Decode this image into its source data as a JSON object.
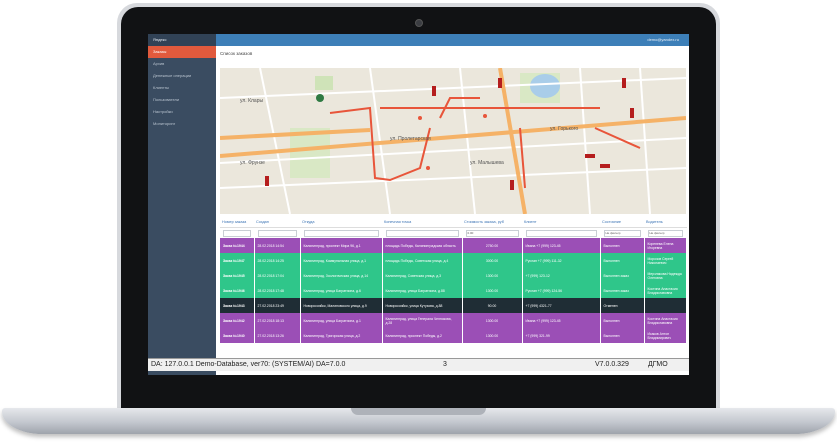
{
  "app": {
    "brand": "Яндекс"
  },
  "sidebar": {
    "items": [
      {
        "label": "Заказы",
        "active": true
      },
      {
        "label": "Архив",
        "active": false
      },
      {
        "label": "Денежные операции",
        "active": false
      },
      {
        "label": "Клиенты",
        "active": false
      },
      {
        "label": "Пользователи",
        "active": false
      },
      {
        "label": "Настройки",
        "active": false
      },
      {
        "label": "Мониторинг",
        "active": false
      }
    ]
  },
  "topbar": {
    "user": "demo@yandex.ru"
  },
  "page": {
    "title": "Список заказов"
  },
  "map_labels": [
    "ул. Клары",
    "ул. Фрунзе",
    "ул. Пролетарская",
    "ул. Горького",
    "ул. Малышева"
  ],
  "table": {
    "headers": [
      "Номер заказа",
      "Создан",
      "Откуда",
      "Конечная точка",
      "Стоимость заказа, руб",
      "Клиент",
      "Состояние",
      "Водитель"
    ],
    "filter_value": "0.00",
    "filter_state": "Не фильтр",
    "rows": [
      {
        "num": "Заказ №1944",
        "created": "28.02.2018 14:54",
        "from": "Калининград, проспект Мира 96, д.1",
        "to": "площадь Победы, Калининградская область",
        "price": "2750.00",
        "client": "Ивана +7 (999) 123-45",
        "state": "Выполнен",
        "driver": "Коренева Елена Игоревна"
      },
      {
        "num": "Заказ №1947",
        "created": "28.02.2018 14:25",
        "from": "Калининград, Коммунальная улица, д.1",
        "to": "площадь Победы, Советская улица, д.4",
        "price": "3000.00",
        "client": "Руслан +7 (999) 111-32",
        "state": "Выполнен",
        "driver": "Морозов Сергей Николаевич"
      },
      {
        "num": "Заказ №1945",
        "created": "28.02.2018 17:04",
        "from": "Калининград, Зоологическая улица, д.14",
        "to": "Калининград, Советская улица, д.3",
        "price": "1300.00",
        "client": "+7 (999) 123-12",
        "state": "Выполнен заказ",
        "driver": "Мерзлякова Надежда Олеговна"
      },
      {
        "num": "Заказ №1946",
        "created": "28.02.2018 17:48",
        "from": "Калининград, улица Багратиона, д.6",
        "to": "Калининград, улица Багратиона, д.88",
        "price": "1300.00",
        "client": "Руслан +7 (999) 124-56",
        "state": "Выполнен заказ",
        "driver": "Костина Анастасия Владиславовна"
      },
      {
        "num": "Заказ №1943",
        "created": "27.02.2018 23:49",
        "from": "Новороссийск, Малиновского улица, д.9",
        "to": "Новороссийск, улица Кутузова, д.88",
        "price": "90.00",
        "client": "+7 (999) 4321-77",
        "state": "Отменен",
        "driver": ""
      },
      {
        "num": "Заказ №1942",
        "created": "27.02.2018 18:13",
        "from": "Калининград, улица Багратиона, д.1",
        "to": "Калининград, улица Генерала Челнокова, д.28",
        "price": "1300.00",
        "client": "Ивана +7 (999) 123-45",
        "state": "Выполнен",
        "driver": "Костина Анастасия Владиславовна"
      },
      {
        "num": "Заказ №1940",
        "created": "27.02.2018 13:26",
        "from": "Калининград, Тригорская улица, д.2",
        "to": "Калининград, проспект Победы, д.2",
        "price": "1300.00",
        "client": "+7 (999) 321-99",
        "state": "Выполнен",
        "driver": "Исаков Антон Владимирович"
      }
    ]
  },
  "statusbar": {
    "left": "DA: 127.0.0.1 Demo-Database, ver70: (SYSTEM/AI) DA=7.0.0",
    "mid": "3",
    "version": "V7.0.0.329",
    "mode": "ДГМО"
  },
  "colors": {
    "sidebar": "#3a4c61",
    "topbar": "#3d7fb8",
    "active": "#e15a3d",
    "purple": "#9b4fb6",
    "green": "#2fc68a",
    "dark": "#1f2d35"
  }
}
